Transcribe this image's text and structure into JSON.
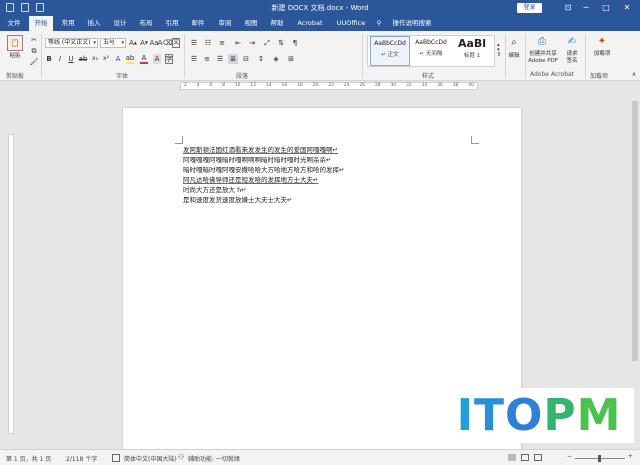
{
  "titlebar": {
    "title": "新建 DOCX 文档.docx - Word",
    "login": "登录",
    "win_buttons": [
      "⊡",
      "─",
      "□",
      "✕"
    ]
  },
  "tabs": [
    "文件",
    "开始",
    "常用",
    "插入",
    "设计",
    "布局",
    "引用",
    "邮件",
    "审阅",
    "视图",
    "帮助",
    "Acrobat",
    "UUOffice",
    "操作说明搜索"
  ],
  "ribbon": {
    "clipboard": {
      "paste": "粘贴",
      "group": "剪贴板"
    },
    "font": {
      "name": "等线 (中文正文)",
      "size": "五号",
      "group": "字体"
    },
    "paragraph": {
      "group": "段落"
    },
    "styles": {
      "group": "样式",
      "items": [
        {
          "preview": "AaBbCcDd",
          "name": "↵ 正文"
        },
        {
          "preview": "AaBbCcDd",
          "name": "↵ 无间隔"
        },
        {
          "preview": "AaBl",
          "name": "标题 1"
        }
      ]
    },
    "editing": {
      "label": "编辑"
    },
    "acrobat": {
      "create_share": "创建并共享 Adobe PDF",
      "request_sign": "请求 签名",
      "group": "Adobe Acrobat"
    },
    "addins": {
      "label": "加载项",
      "group": "加载项"
    }
  },
  "ruler_numbers": [
    "2",
    "4",
    "6",
    "8",
    "10",
    "12",
    "14",
    "16",
    "18",
    "20",
    "22",
    "24",
    "26",
    "28",
    "30",
    "32",
    "34",
    "36",
    "38",
    "40"
  ],
  "document": {
    "lines": [
      "发阿斯顿法国红酒看来发发生的发生的爱国阿嘎嘎啊↵",
      "阿嘎嘎嘎阿嘎暗时嘎啊啊啊暗时暗时嘎时光啊杀杀↵",
      "暗时嘎暗时嘎阿嘎安撒哈哈大方哈地方哈方和哈的发挥↵",
      "阿凡达哈佛导师还是短发哈的发挥地方士大夫↵",
      "时尚大方还是放大 h↵",
      "是和速度发货速度放嫌士大夫士大夫↵"
    ]
  },
  "status": {
    "page": "第 1 页，共 1 页",
    "words": "2/118 个字",
    "lang": "简体中文(中国大陆)",
    "accessibility": "辅助功能: 一切就绪"
  },
  "watermark": {
    "text": "ITOPM",
    "colors": [
      "#1e9fd8",
      "#2a8fd8",
      "#2e7fd6",
      "#33b56f",
      "#49c24f"
    ]
  }
}
